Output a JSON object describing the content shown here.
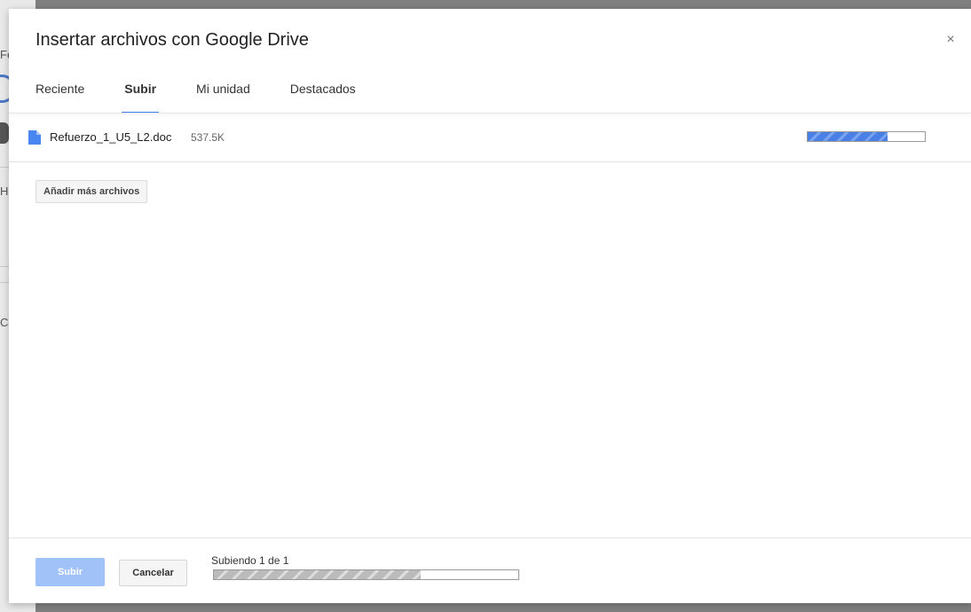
{
  "dialog": {
    "title": "Insertar archivos con Google Drive",
    "close_label": "×"
  },
  "tabs": [
    {
      "label": "Reciente",
      "active": false
    },
    {
      "label": "Subir",
      "active": true
    },
    {
      "label": "Mi unidad",
      "active": false
    },
    {
      "label": "Destacados",
      "active": false
    }
  ],
  "file": {
    "icon": "doc-file-icon",
    "name": "Refuerzo_1_U5_L2.doc",
    "size": "537.5K",
    "progress_fraction": 0.68,
    "progress_color": "#4a7fe6"
  },
  "actions": {
    "add_files_label": "Añadir más archivos",
    "upload_label": "Subir",
    "cancel_label": "Cancelar"
  },
  "status": {
    "text": "Subiendo 1 de 1",
    "progress_fraction": 0.68
  },
  "colors": {
    "accent": "#4285f4",
    "upload_button_disabled": "#a1c2f9"
  }
}
